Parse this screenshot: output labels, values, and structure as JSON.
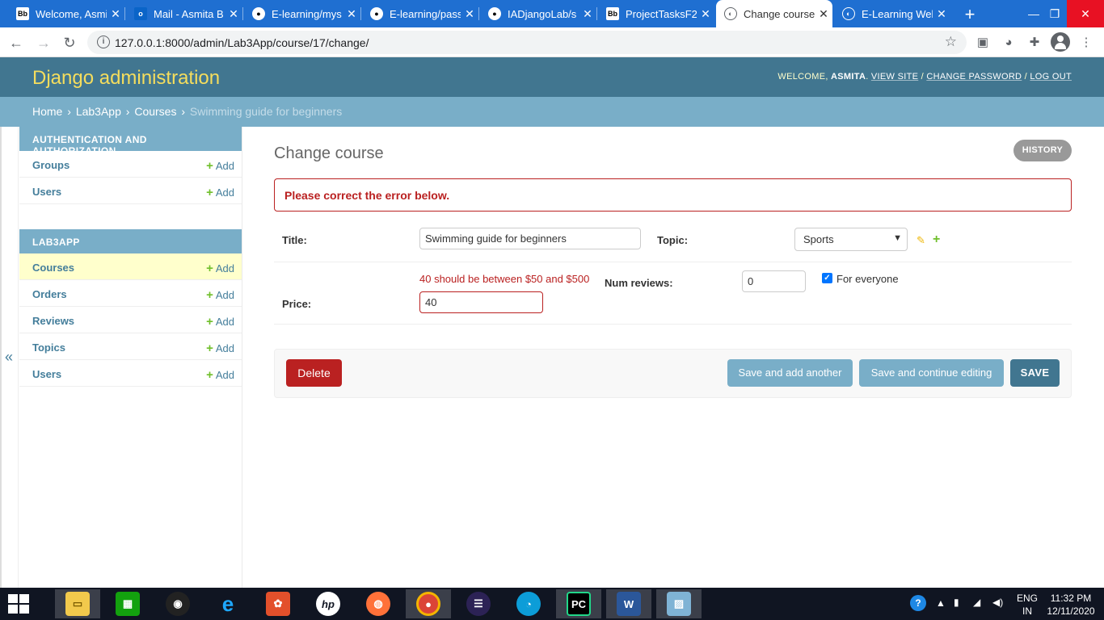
{
  "browser": {
    "tabs": [
      {
        "title": "Welcome, Asmi",
        "icon": "blackboard-icon"
      },
      {
        "title": "Mail - Asmita B",
        "icon": "outlook-icon"
      },
      {
        "title": "E-learning/mys",
        "icon": "github-icon"
      },
      {
        "title": "E-learning/pass",
        "icon": "github-icon"
      },
      {
        "title": "IADjangoLab/s",
        "icon": "github-icon"
      },
      {
        "title": "ProjectTasksF2(",
        "icon": "blackboard-icon"
      },
      {
        "title": "Change course",
        "icon": "globe-icon"
      },
      {
        "title": "E-Learning Wel",
        "icon": "globe-icon"
      }
    ],
    "url": "127.0.0.1:8000/admin/Lab3App/course/17/change/"
  },
  "header": {
    "brand": "Django administration",
    "welcome": "WELCOME,",
    "user": "ASMITA",
    "view_site": "VIEW SITE",
    "change_password": "CHANGE PASSWORD",
    "log_out": "LOG OUT"
  },
  "breadcrumbs": {
    "home": "Home",
    "app": "Lab3App",
    "model": "Courses",
    "current": "Swimming guide for beginners"
  },
  "sidebar": {
    "toggle": "«",
    "modules": [
      {
        "caption": "AUTHENTICATION AND AUTHORIZATION",
        "items": [
          {
            "name": "Groups",
            "add": "Add"
          },
          {
            "name": "Users",
            "add": "Add"
          }
        ]
      },
      {
        "caption": "LAB3APP",
        "items": [
          {
            "name": "Courses",
            "add": "Add"
          },
          {
            "name": "Orders",
            "add": "Add"
          },
          {
            "name": "Reviews",
            "add": "Add"
          },
          {
            "name": "Topics",
            "add": "Add"
          },
          {
            "name": "Users",
            "add": "Add"
          }
        ]
      }
    ]
  },
  "content": {
    "title": "Change course",
    "history": "HISTORY",
    "errornote": "Please correct the error below.",
    "form": {
      "title_label": "Title:",
      "title_value": "Swimming guide for beginners",
      "topic_label": "Topic:",
      "topic_value": "Sports",
      "price_label": "Price:",
      "price_error": "40 should be between $50 and $500",
      "price_value": "40",
      "num_reviews_label": "Num reviews:",
      "num_reviews_value": "0",
      "for_everyone_label": "For everyone",
      "for_everyone_checked": true
    },
    "buttons": {
      "delete": "Delete",
      "save_add_another": "Save and add another",
      "save_continue": "Save and continue editing",
      "save": "SAVE"
    }
  },
  "taskbar": {
    "apps": [
      "file-explorer-icon",
      "store-icon",
      "camera-icon",
      "internet-explorer-icon",
      "photos-icon",
      "hp-icon",
      "firefox-icon",
      "chrome-icon",
      "eclipse-icon",
      "edge-icon",
      "pycharm-icon",
      "word-icon",
      "photo-viewer-icon"
    ],
    "lang": "ENG",
    "region": "IN",
    "time": "11:32 PM",
    "date": "12/11/2020"
  },
  "colors": {
    "header_bg": "#417690",
    "breadcrumb_bg": "#79aec8",
    "brand": "#f5dd5d",
    "error": "#ba2121",
    "add_green": "#70bf2b",
    "current_row": "#ffffcc"
  }
}
